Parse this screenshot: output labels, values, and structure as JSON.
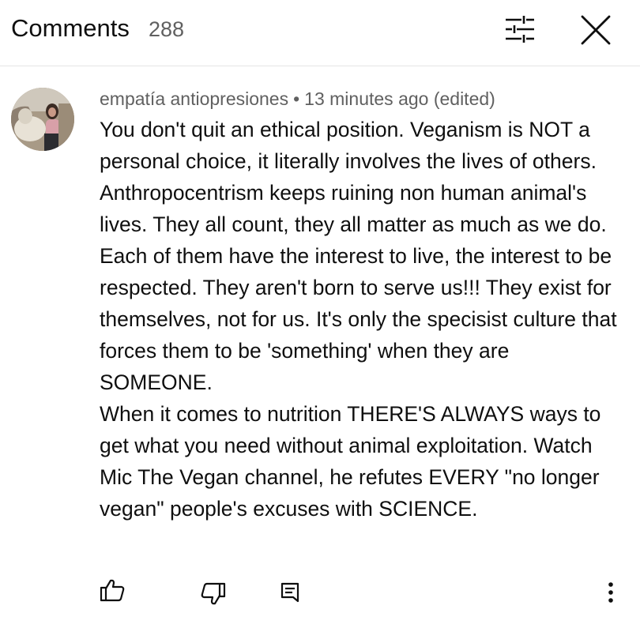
{
  "header": {
    "title": "Comments",
    "count": "288",
    "filter_icon": "sliders-icon",
    "close_icon": "close-icon"
  },
  "comment": {
    "author": "empatía antiopresiones",
    "separator": "•",
    "time": "13 minutes ago (edited)",
    "paragraphs": [
      "You don't quit an ethical position. Veganism is NOT a personal choice, it literally involves the lives of others.",
      "Anthropocentrism keeps ruining non human animal's lives. They all count, they all matter as much as we do. Each of them have the interest to live, the interest to be respected. They aren't born to serve us!!! They exist for themselves, not for us. It's only the specisist culture that forces them to be 'something' when they are SOMEONE.",
      "When it comes to nutrition THERE'S ALWAYS ways to get what you need without animal exploitation. Watch Mic The Vegan channel, he refutes EVERY \"no longer vegan\" people's excuses with SCIENCE."
    ],
    "actions": {
      "like_icon": "thumbs-up-icon",
      "dislike_icon": "thumbs-down-icon",
      "reply_icon": "reply-icon",
      "more_icon": "more-vertical-icon"
    }
  },
  "colors": {
    "text": "#0f0f0f",
    "secondary_text": "#606060",
    "divider": "#e5e5e5",
    "background": "#ffffff"
  }
}
